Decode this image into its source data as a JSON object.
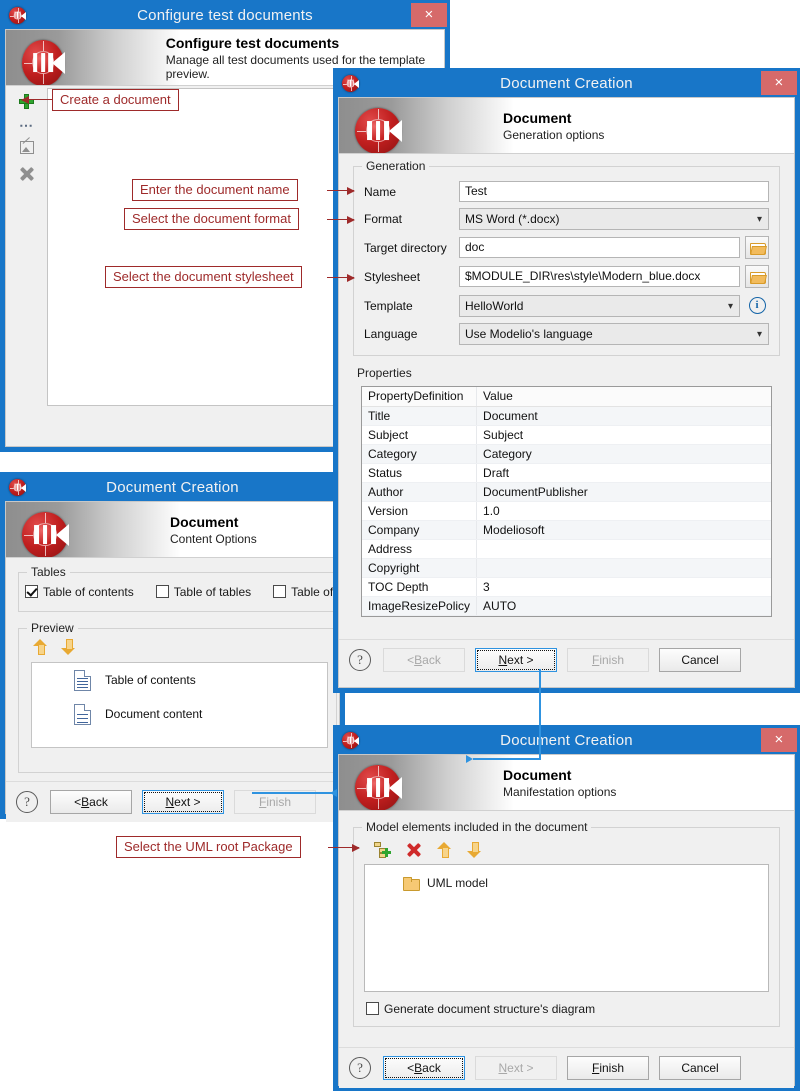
{
  "app": {
    "logo_name": "modelio-logo"
  },
  "window_configure": {
    "title": "Configure test documents",
    "close_label": "×",
    "header_title": "Configure test documents",
    "header_subtitle": "Manage all test documents used for the template preview.",
    "toolbar": [
      {
        "name": "add-document",
        "glyph": "+"
      },
      {
        "name": "more-options",
        "glyph": "⋯"
      },
      {
        "name": "edit-document",
        "glyph": "✎"
      },
      {
        "name": "delete-document",
        "glyph": "✖"
      }
    ]
  },
  "window_generation": {
    "title": "Document Creation",
    "close_label": "×",
    "header_title": "Document",
    "header_subtitle": "Generation options",
    "group_generation_label": "Generation",
    "fields": {
      "name_label": "Name",
      "name_value": "Test",
      "format_label": "Format",
      "format_value": "MS Word (*.docx)",
      "target_label": "Target directory",
      "target_value": "doc",
      "stylesheet_label": "Stylesheet",
      "stylesheet_value": "$MODULE_DIR\\res\\style\\Modern_blue.docx",
      "template_label": "Template",
      "template_value": "HelloWorld",
      "language_label": "Language",
      "language_value": "Use Modelio's language"
    },
    "group_properties_label": "Properties",
    "properties_table": {
      "columns": [
        "PropertyDefinition",
        "Value"
      ],
      "rows": [
        [
          "Title",
          "Document"
        ],
        [
          "Subject",
          "Subject"
        ],
        [
          "Category",
          "Category"
        ],
        [
          "Status",
          "Draft"
        ],
        [
          "Author",
          "DocumentPublisher"
        ],
        [
          "Version",
          "1.0"
        ],
        [
          "Company",
          "Modeliosoft"
        ],
        [
          "Address",
          ""
        ],
        [
          "Copyright",
          ""
        ],
        [
          "TOC Depth",
          "3"
        ],
        [
          "ImageResizePolicy",
          "AUTO"
        ]
      ]
    },
    "buttons": {
      "help": "?",
      "back": "< Back",
      "next": "Next >",
      "finish": "Finish",
      "cancel": "Cancel"
    }
  },
  "window_content": {
    "title": "Document Creation",
    "header_title": "Document",
    "header_subtitle": "Content Options",
    "group_tables_label": "Tables",
    "checkboxes": [
      {
        "label": "Table of contents",
        "checked": true
      },
      {
        "label": "Table of tables",
        "checked": false
      },
      {
        "label": "Table of figures",
        "checked": false
      }
    ],
    "group_preview_label": "Preview",
    "preview_items": [
      {
        "label": "Table of contents"
      },
      {
        "label": "Document content"
      }
    ],
    "buttons": {
      "help": "?",
      "back": "< Back",
      "next": "Next >",
      "finish": "Finish"
    }
  },
  "window_manifestation": {
    "title": "Document Creation",
    "close_label": "×",
    "header_title": "Document",
    "header_subtitle": "Manifestation options",
    "group_label": "Model elements included in the document",
    "tree_items": [
      {
        "label": "UML model"
      }
    ],
    "generate_diagram_label": "Generate document structure's diagram",
    "generate_diagram_checked": false,
    "buttons": {
      "help": "?",
      "back": "< Back",
      "next": "Next >",
      "finish": "Finish",
      "cancel": "Cancel"
    }
  },
  "annotations": [
    {
      "text": "Create a document"
    },
    {
      "text": "Enter the document name"
    },
    {
      "text": "Select the document format"
    },
    {
      "text": "Select the document stylesheet"
    },
    {
      "text": "Select the UML root Package"
    }
  ],
  "colors": {
    "titlebar_blue": "#1876c8",
    "close_red": "#d66a6a",
    "annotation_red": "#9e2a2a",
    "flow_blue": "#2f93e0",
    "logo_red": "#c11f1f"
  }
}
